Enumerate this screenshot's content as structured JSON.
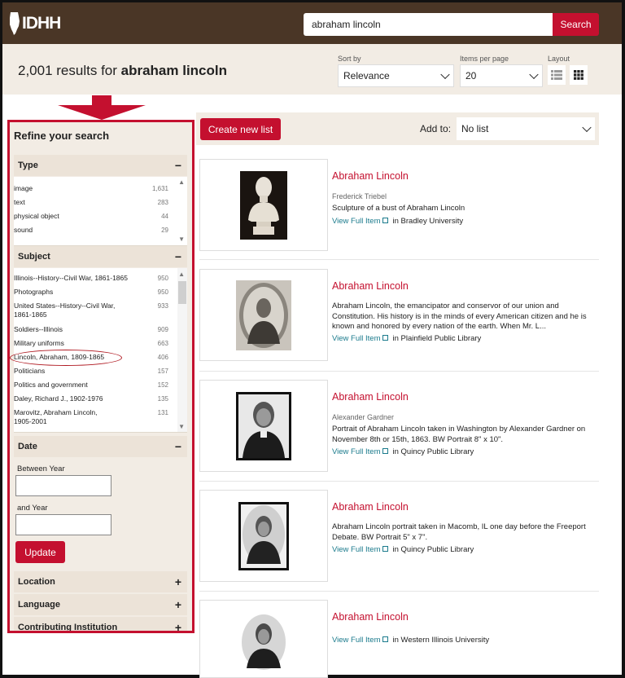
{
  "header": {
    "logo_text": "IDHH",
    "search_value": "abraham lincoln",
    "search_button": "Search"
  },
  "results_bar": {
    "count": "2,001",
    "count_mid": " results for ",
    "query": "abraham lincoln",
    "sort_label": "Sort by",
    "sort_value": "Relevance",
    "per_page_label": "Items per page",
    "per_page_value": "20",
    "layout_label": "Layout"
  },
  "sidebar": {
    "title": "Refine your search",
    "type_facet": {
      "label": "Type",
      "toggle": "−",
      "items": [
        {
          "name": "image",
          "count": "1,631"
        },
        {
          "name": "text",
          "count": "283"
        },
        {
          "name": "physical object",
          "count": "44"
        },
        {
          "name": "sound",
          "count": "29"
        }
      ]
    },
    "subject_facet": {
      "label": "Subject",
      "toggle": "−",
      "items": [
        {
          "name": "Illinois--History--Civil War, 1861-1865",
          "count": "950"
        },
        {
          "name": "Photographs",
          "count": "950"
        },
        {
          "name": "United States--History--Civil War, 1861-1865",
          "count": "933"
        },
        {
          "name": "Soldiers--Illinois",
          "count": "909"
        },
        {
          "name": "Military uniforms",
          "count": "663"
        },
        {
          "name": "Lincoln, Abraham, 1809-1865",
          "count": "406"
        },
        {
          "name": "Politicians",
          "count": "157"
        },
        {
          "name": "Politics and government",
          "count": "152"
        },
        {
          "name": "Daley, Richard J., 1902-1976",
          "count": "135"
        },
        {
          "name": "Marovitz, Abraham Lincoln, 1905-2001",
          "count": "131"
        }
      ]
    },
    "date_facet": {
      "label": "Date",
      "toggle": "−",
      "between_label": "Between Year",
      "and_label": "and Year",
      "update_button": "Update"
    },
    "collapsed_facets": [
      {
        "label": "Location",
        "toggle": "+"
      },
      {
        "label": "Language",
        "toggle": "+"
      },
      {
        "label": "Contributing Institution",
        "toggle": "+"
      }
    ]
  },
  "toolbar": {
    "create_button": "Create new list",
    "add_to_label": "Add to:",
    "add_to_value": "No list"
  },
  "results": [
    {
      "title": "Abraham Lincoln",
      "creator": "Frederick Triebel",
      "description": "Sculpture of a bust of Abraham Lincoln",
      "link": "View Full Item",
      "in_prefix": "in ",
      "institution": "Bradley University"
    },
    {
      "title": "Abraham Lincoln",
      "creator": "",
      "description": "Abraham Lincoln, the emancipator and conservor of our union and Constitution. His history is in the minds of every American citizen and he is known and honored by every nation of the earth. When Mr. L...",
      "link": "View Full Item",
      "in_prefix": "in ",
      "institution": "Plainfield Public Library"
    },
    {
      "title": "Abraham Lincoln",
      "creator": "Alexander Gardner",
      "description": "Portrait of Abraham Lincoln taken in Washington by Alexander Gardner on November 8th or 15th, 1863. BW Portrait 8\" x 10\".",
      "link": "View Full Item",
      "in_prefix": "in ",
      "institution": "Quincy Public Library"
    },
    {
      "title": "Abraham Lincoln",
      "creator": "",
      "description": "Abraham Lincoln portrait taken in Macomb, IL one day before the Freeport Debate. BW Portrait 5\" x 7\".",
      "link": "View Full Item",
      "in_prefix": "in ",
      "institution": "Quincy Public Library"
    },
    {
      "title": "Abraham Lincoln",
      "creator": "",
      "description": "",
      "link": "View Full Item",
      "in_prefix": "in ",
      "institution": "Western Illinois University"
    }
  ],
  "colors": {
    "brand_red": "#c4102f",
    "header_brown": "#4a3626",
    "panel_beige": "#f2ece4",
    "link_teal": "#1a7a8c"
  }
}
